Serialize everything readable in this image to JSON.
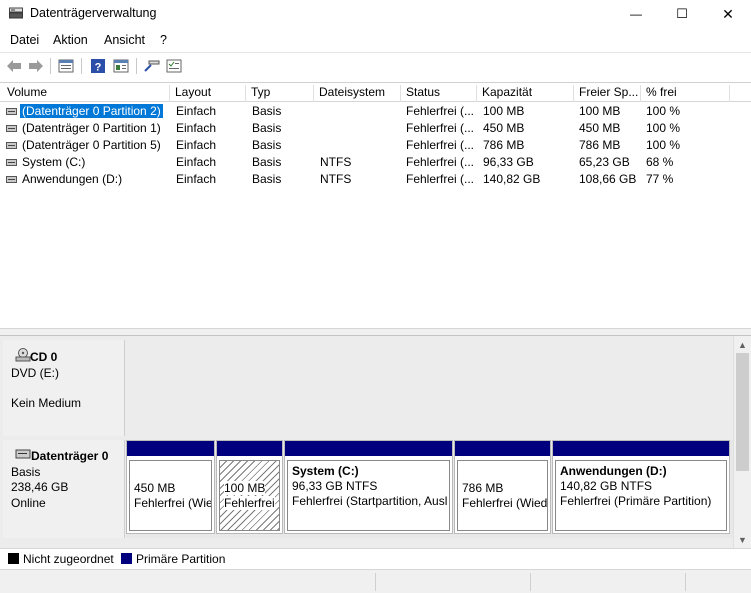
{
  "window": {
    "title": "Datenträgerverwaltung",
    "minimize": "—",
    "maximize": "☐",
    "close": "✕"
  },
  "menu": [
    "Datei",
    "Aktion",
    "Ansicht",
    "?"
  ],
  "toolbar": {
    "icons": [
      "back-icon",
      "forward-icon",
      "properties-icon",
      "help-icon",
      "view-icon",
      "connect-icon",
      "list-icon"
    ]
  },
  "volume_list": {
    "columns": [
      "Volume",
      "Layout",
      "Typ",
      "Dateisystem",
      "Status",
      "Kapazität",
      "Freier Sp...",
      "% frei"
    ],
    "rows": [
      {
        "volume": "(Datenträger 0 Partition 2)",
        "layout": "Einfach",
        "typ": "Basis",
        "dateisystem": "",
        "status": "Fehlerfrei (...",
        "kapazitaet": "100 MB",
        "frei": "100 MB",
        "prozent": "100 %"
      },
      {
        "volume": "(Datenträger 0 Partition 1)",
        "layout": "Einfach",
        "typ": "Basis",
        "dateisystem": "",
        "status": "Fehlerfrei (...",
        "kapazitaet": "450 MB",
        "frei": "450 MB",
        "prozent": "100 %"
      },
      {
        "volume": "(Datenträger 0 Partition 5)",
        "layout": "Einfach",
        "typ": "Basis",
        "dateisystem": "",
        "status": "Fehlerfrei (...",
        "kapazitaet": "786 MB",
        "frei": "786 MB",
        "prozent": "100 %"
      },
      {
        "volume": "System (C:)",
        "layout": "Einfach",
        "typ": "Basis",
        "dateisystem": "NTFS",
        "status": "Fehlerfrei (...",
        "kapazitaet": "96,33 GB",
        "frei": "65,23 GB",
        "prozent": "68 %"
      },
      {
        "volume": "Anwendungen (D:)",
        "layout": "Einfach",
        "typ": "Basis",
        "dateisystem": "NTFS",
        "status": "Fehlerfrei (...",
        "kapazitaet": "140,82 GB",
        "frei": "108,66 GB",
        "prozent": "77 %"
      }
    ]
  },
  "disks": {
    "cd0": {
      "name": "CD 0",
      "device": "DVD (E:)",
      "media": "Kein Medium"
    },
    "disk0": {
      "name": "Datenträger 0",
      "type": "Basis",
      "size": "238,46 GB",
      "state": "Online",
      "partitions": [
        {
          "title": "",
          "line1": "450 MB",
          "line2": "Fehlerfrei (Wie"
        },
        {
          "title": "",
          "line1": "100 MB",
          "line2": "Fehlerfrei"
        },
        {
          "title": "System  (C:)",
          "line1": "96,33 GB NTFS",
          "line2": "Fehlerfrei (Startpartition, Ausl"
        },
        {
          "title": "",
          "line1": "786 MB",
          "line2": "Fehlerfrei (Wied"
        },
        {
          "title": "Anwendungen  (D:)",
          "line1": "140,82 GB NTFS",
          "line2": "Fehlerfrei (Primäre Partition)"
        }
      ]
    }
  },
  "legend": [
    {
      "label": "Nicht zugeordnet",
      "color": "#000000"
    },
    {
      "label": "Primäre Partition",
      "color": "#00007f"
    }
  ]
}
